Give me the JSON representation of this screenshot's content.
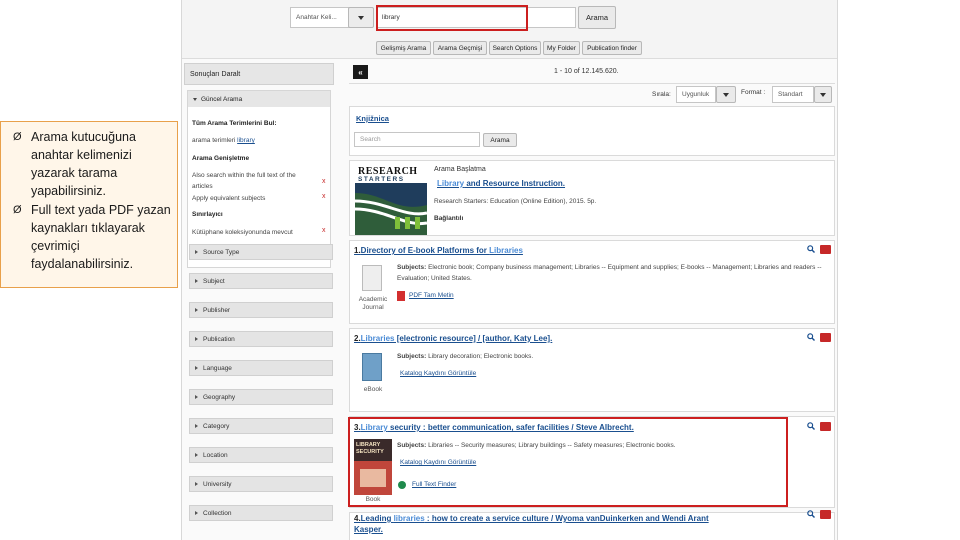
{
  "search": {
    "field_dropdown": "Anahtar Keli...",
    "query": "library",
    "search_button": "Arama",
    "tools": [
      "Gelişmiş Arama",
      "Arama Geçmişi",
      "Search Options",
      "My Folder",
      "Publication finder"
    ]
  },
  "sidebar": {
    "header": "Sonuçları Daralt",
    "current_search": {
      "title": "Güncel Arama",
      "all_terms_label": "Tüm Arama Terimlerini Bul:",
      "terms_prefix": "arama terimleri",
      "terms_link": "library",
      "expanders_label": "Arama Genişletme",
      "expander_1": "Also search within the full text of the articles",
      "expander_2": "Apply equivalent subjects",
      "limiters_label": "Sınırlayıcı",
      "limiter_1": "Kütüphane koleksiyonunda mevcut",
      "remove": "x"
    },
    "facets": [
      "Source Type",
      "Subject",
      "Publisher",
      "Publication",
      "Language",
      "Geography",
      "Category",
      "Location",
      "University",
      "Collection"
    ]
  },
  "results_bar": {
    "collapse": "«",
    "count": "1 - 10 of 12.145.620.",
    "sort_label": "Sırala:",
    "sort_value": "Uygunluk",
    "format_label": "Format :",
    "format_value": "Standart"
  },
  "knjiznica": {
    "title": "Knjižnica",
    "placeholder": "Search",
    "button": "Arama"
  },
  "research_starter": {
    "logo_line1": "RESEARCH",
    "logo_line2": "STARTERS",
    "heading": "Arama Başlatma",
    "title_hl": "Library",
    "title_rest": " and Resource Instruction.",
    "source": "Research Starters: Education (Online Edition), 2015. 5p.",
    "links_label": "Bağlantılı"
  },
  "results": [
    {
      "num": "1.",
      "title_pre": "Directory of E-book Platforms for ",
      "title_hl": "Libraries",
      "title_post": "",
      "title_line2": "",
      "subjects_label": "Subjects:",
      "subjects": "Electronic book; Company business management; Libraries -- Equipment and supplies; E-books -- Management; Libraries and readers -- Evaluation; United States.",
      "type_label": "Academic Journal",
      "link1": "PDF Tam Metin",
      "link2": ""
    },
    {
      "num": "2.",
      "title_pre": "",
      "title_hl": "Libraries",
      "title_post": " [electronic resource] / [author, Katy Lee].",
      "title_line2": "",
      "subjects_label": "Subjects:",
      "subjects": "Library decoration; Electronic books.",
      "type_label": "eBook",
      "link1": "Katalog Kaydını Görüntüle",
      "link2": ""
    },
    {
      "num": "3.",
      "title_pre": "",
      "title_hl": "Library",
      "title_post": " security : better communication, safer facilities / Steve Albrecht.",
      "title_line2": "",
      "subjects_label": "Subjects:",
      "subjects": "Libraries -- Security measures; Library buildings -- Safety measures; Electronic books.",
      "type_label": "Book",
      "cover_text": "LIBRARY SECURITY",
      "link1": "Katalog Kaydını Görüntüle",
      "link2": "Full Text Finder"
    },
    {
      "num": "4.",
      "title_pre": "Leading ",
      "title_hl": "libraries",
      "title_post": " : how to create a service culture / Wyoma vanDuinkerken and Wendi Arant",
      "title_line2": "Kasper.",
      "subjects_label": "",
      "subjects": "",
      "type_label": "",
      "link1": "",
      "link2": ""
    }
  ],
  "note": {
    "bullet": "Ø",
    "items": [
      "Arama kutucuğuna anahtar kelimenizi yazarak tarama yapabilirsiniz.",
      "Full text yada PDF yazan kaynakları tıklayarak çevrimiçi faydalanabilirsiniz."
    ]
  },
  "colors": {
    "highlight_box": "#cc1f1f",
    "link": "#1a4f8f",
    "note_border": "#e8a04a"
  }
}
